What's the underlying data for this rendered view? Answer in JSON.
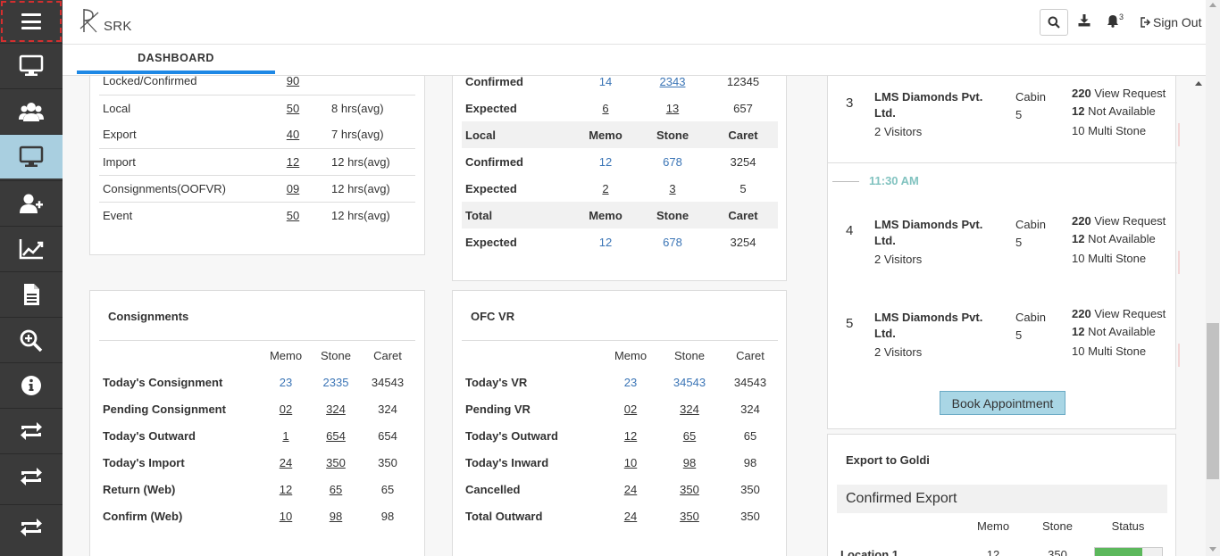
{
  "app": {
    "logo_text": "SRK"
  },
  "header": {
    "bell_count": "3",
    "sign_out": "Sign Out"
  },
  "tabs": [
    {
      "label": "DASHBOARD"
    }
  ],
  "sidebar": {
    "items": [
      {
        "icon": "monitor-icon"
      },
      {
        "icon": "users-icon"
      },
      {
        "icon": "monitor-icon",
        "active": true
      },
      {
        "icon": "add-user-icon"
      },
      {
        "icon": "line-chart-icon"
      },
      {
        "icon": "document-icon"
      },
      {
        "icon": "zoom-in-icon"
      },
      {
        "icon": "info-icon"
      },
      {
        "icon": "exchange-icon"
      },
      {
        "icon": "exchange-icon"
      },
      {
        "icon": "exchange-icon"
      }
    ]
  },
  "locked_card": {
    "rows": [
      {
        "label": "Locked/Confirmed",
        "count": "90",
        "avg": ""
      },
      {
        "label": "Local",
        "count": "50",
        "avg": "8 hrs(avg)"
      },
      {
        "label": "Export",
        "count": "40",
        "avg": "7 hrs(avg)"
      },
      {
        "label": "Import",
        "count": "12",
        "avg": "12 hrs(avg)"
      },
      {
        "label": "Consignments(OOFVR)",
        "count": "09",
        "avg": "12 hrs(avg)"
      },
      {
        "label": "Event",
        "count": "50",
        "avg": "12 hrs(avg)"
      }
    ]
  },
  "summary_card": {
    "top_rows": [
      {
        "label": "Confirmed",
        "memo": "14",
        "stone": "2343",
        "caret": "12345"
      },
      {
        "label": "Expected",
        "memo": "6",
        "stone": "13",
        "caret": "657"
      }
    ],
    "local_header": {
      "label": "Local",
      "memo": "Memo",
      "stone": "Stone",
      "caret": "Caret"
    },
    "local_rows": [
      {
        "label": "Confirmed",
        "memo": "12",
        "stone": "678",
        "caret": "3254"
      },
      {
        "label": "Expected",
        "memo": "2",
        "stone": "3",
        "caret": "5"
      }
    ],
    "total_header": {
      "label": "Total",
      "memo": "Memo",
      "stone": "Stone",
      "caret": "Caret"
    },
    "total_rows": [
      {
        "label": "Expected",
        "memo": "12",
        "stone": "678",
        "caret": "3254"
      }
    ]
  },
  "consignments": {
    "title": "Consignments",
    "headers": {
      "memo": "Memo",
      "stone": "Stone",
      "caret": "Caret"
    },
    "rows": [
      {
        "label": "Today's Consignment",
        "memo": "23",
        "stone": "2335",
        "caret": "34543"
      },
      {
        "label": "Pending Consignment",
        "memo": "02",
        "stone": "324",
        "caret": "324"
      },
      {
        "label": "Today's Outward",
        "memo": "1",
        "stone": "654",
        "caret": "654"
      },
      {
        "label": "Today's Import",
        "memo": "24",
        "stone": "350",
        "caret": "350"
      },
      {
        "label": "Return (Web)",
        "memo": "12",
        "stone": "65",
        "caret": "65"
      },
      {
        "label": "Confirm (Web)",
        "memo": "10",
        "stone": "98",
        "caret": "98"
      }
    ]
  },
  "ofc_vr": {
    "title": "OFC VR",
    "headers": {
      "memo": "Memo",
      "stone": "Stone",
      "caret": "Caret"
    },
    "rows": [
      {
        "label": "Today's VR",
        "memo": "23",
        "stone": "34543",
        "caret": "34543"
      },
      {
        "label": "Pending VR",
        "memo": "02",
        "stone": "324",
        "caret": "324"
      },
      {
        "label": "Today's Outward",
        "memo": "12",
        "stone": "65",
        "caret": "65"
      },
      {
        "label": "Today's Inward",
        "memo": "10",
        "stone": "98",
        "caret": "98"
      },
      {
        "label": "Cancelled",
        "memo": "24",
        "stone": "350",
        "caret": "350"
      },
      {
        "label": "Total Outward",
        "memo": "24",
        "stone": "350",
        "caret": "350"
      }
    ]
  },
  "appointments": {
    "time_slot": "11:30 AM",
    "items": [
      {
        "num": "3",
        "company": "LMS Diamonds Pvt. Ltd.",
        "visitors": "2 Visitors",
        "cabin_label": "Cabin",
        "cabin_no": "5",
        "line1_bold": "220",
        "line1_text": " View Request",
        "line2_bold": "12",
        "line2_text": " Not Available",
        "line3": "10 Multi Stone"
      },
      {
        "num": "4",
        "company": "LMS Diamonds Pvt. Ltd.",
        "visitors": "2 Visitors",
        "cabin_label": "Cabin",
        "cabin_no": "5",
        "line1_bold": "220",
        "line1_text": " View Request",
        "line2_bold": "12",
        "line2_text": " Not Available",
        "line3": "10 Multi Stone"
      },
      {
        "num": "5",
        "company": "LMS Diamonds Pvt. Ltd.",
        "visitors": "2 Visitors",
        "cabin_label": "Cabin",
        "cabin_no": "5",
        "line1_bold": "220",
        "line1_text": " View Request",
        "line2_bold": "12",
        "line2_text": " Not Available",
        "line3": "10 Multi Stone"
      }
    ],
    "book_button": "Book Appointment"
  },
  "export_goldi": {
    "title": "Export to Goldi",
    "subtitle": "Confirmed Export",
    "headers": {
      "memo": "Memo",
      "stone": "Stone",
      "status": "Status"
    },
    "rows": [
      {
        "label": "Location 1",
        "memo": "12",
        "stone": "350",
        "status_fraction": 0.7
      }
    ]
  },
  "colors": {
    "sidebar_bg": "#3a3a3a",
    "active_bg": "#a9cfe0",
    "tab_accent": "#1e88e5",
    "link_blue": "#3b75b6",
    "time_teal": "#82c3c0"
  }
}
